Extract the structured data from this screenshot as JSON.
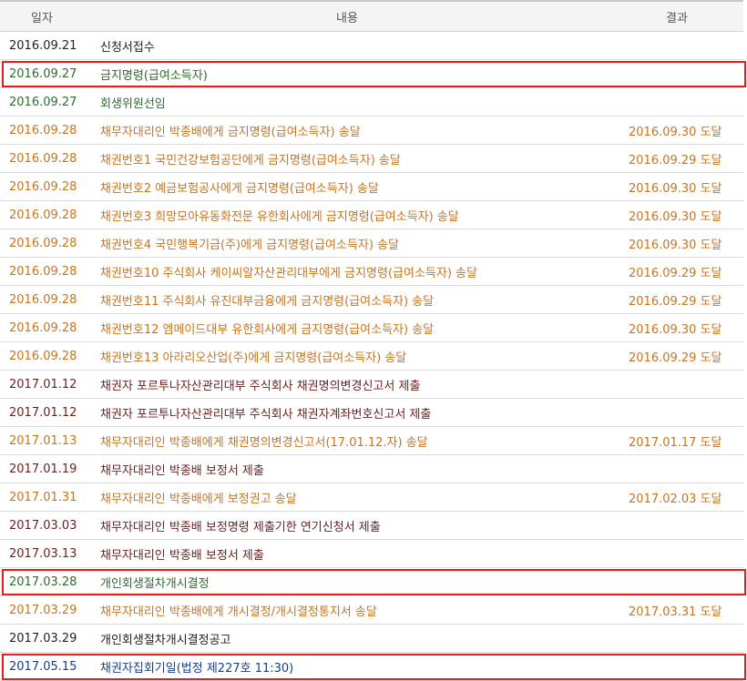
{
  "header": {
    "date": "일자",
    "content": "내용",
    "result": "결과"
  },
  "rows": [
    {
      "date": "2016.09.21",
      "content": "신청서접수",
      "result": "",
      "color": "#222222"
    },
    {
      "date": "2016.09.27",
      "content": "금지명령(급여소득자)",
      "result": "",
      "color": "#2e6b2e",
      "highlighted": true
    },
    {
      "date": "2016.09.27",
      "content": "회생위원선임",
      "result": "",
      "color": "#2e6b2e"
    },
    {
      "date": "2016.09.28",
      "content": "채무자대리인 박종배에게 금지명령(급여소득자) 송달",
      "result": "2016.09.30 도달",
      "color": "#c8741d"
    },
    {
      "date": "2016.09.28",
      "content": "채권번호1 국민건강보험공단에게 금지명령(급여소득자) 송달",
      "result": "2016.09.29 도달",
      "color": "#c8741d"
    },
    {
      "date": "2016.09.28",
      "content": "채권번호2 예금보험공사에게 금지명령(급여소득자) 송달",
      "result": "2016.09.30 도달",
      "color": "#c8741d"
    },
    {
      "date": "2016.09.28",
      "content": "채권번호3 희망모아유동화전문 유한회사에게 금지명령(급여소득자) 송달",
      "result": "2016.09.30 도달",
      "color": "#c8741d"
    },
    {
      "date": "2016.09.28",
      "content": "채권번호4 국민행복기금(주)에게 금지명령(급여소득자) 송달",
      "result": "2016.09.30 도달",
      "color": "#c8741d"
    },
    {
      "date": "2016.09.28",
      "content": "채권번호10 주식회사 케이씨알자산관리대부에게 금지명령(급여소득자) 송달",
      "result": "2016.09.29 도달",
      "color": "#c8741d"
    },
    {
      "date": "2016.09.28",
      "content": "채권번호11 주식회사 유진대부금융에게 금지명령(급여소득자) 송달",
      "result": "2016.09.29 도달",
      "color": "#c8741d"
    },
    {
      "date": "2016.09.28",
      "content": "채권번호12 엠메이드대부 유한회사에게 금지명령(급여소득자) 송달",
      "result": "2016.09.30 도달",
      "color": "#c8741d"
    },
    {
      "date": "2016.09.28",
      "content": "채권번호13 아라리오산업(주)에게 금지명령(급여소득자) 송달",
      "result": "2016.09.29 도달",
      "color": "#c8741d"
    },
    {
      "date": "2017.01.12",
      "content": "채권자 포르투나자산관리대부 주식회사 채권명의변경신고서 제출",
      "result": "",
      "color": "#6b1f1f"
    },
    {
      "date": "2017.01.12",
      "content": "채권자 포르투나자산관리대부 주식회사 채권자계좌번호신고서 제출",
      "result": "",
      "color": "#6b1f1f"
    },
    {
      "date": "2017.01.13",
      "content": "채무자대리인 박종배에게 채권명의변경신고서(17.01.12.자) 송달",
      "result": "2017.01.17 도달",
      "color": "#c8741d"
    },
    {
      "date": "2017.01.19",
      "content": "채무자대리인 박종배 보정서 제출",
      "result": "",
      "color": "#6b1f1f"
    },
    {
      "date": "2017.01.31",
      "content": "채무자대리인 박종배에게 보정권고 송달",
      "result": "2017.02.03 도달",
      "color": "#c8741d"
    },
    {
      "date": "2017.03.03",
      "content": "채무자대리인 박종배 보정명령 제출기한 연기신청서 제출",
      "result": "",
      "color": "#6b1f1f"
    },
    {
      "date": "2017.03.13",
      "content": "채무자대리인 박종배 보정서 제출",
      "result": "",
      "color": "#6b1f1f"
    },
    {
      "date": "2017.03.28",
      "content": "개인회생절차개시결정",
      "result": "",
      "color": "#2e6b2e",
      "highlighted": true
    },
    {
      "date": "2017.03.29",
      "content": "채무자대리인 박종배에게 개시결정/개시결정통지서 송달",
      "result": "2017.03.31 도달",
      "color": "#c8741d"
    },
    {
      "date": "2017.03.29",
      "content": "개인회생절차개시결정공고",
      "result": "",
      "color": "#222222"
    },
    {
      "date": "2017.05.15",
      "content": "채권자집회기일(법정 제227호 11:30)",
      "result": "",
      "color": "#1a3d8a",
      "highlighted": true
    }
  ],
  "colors": {
    "highlight_border": "#e02020",
    "header_bg": "#f4f4f4"
  }
}
